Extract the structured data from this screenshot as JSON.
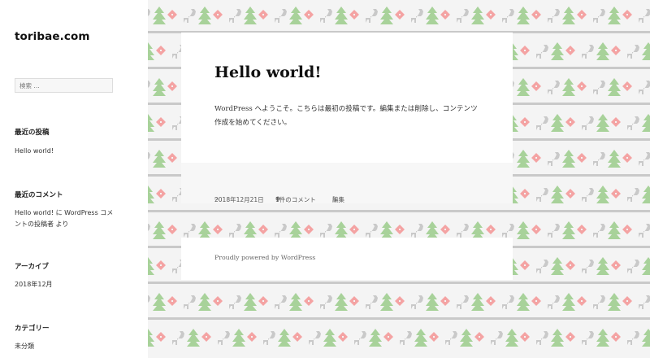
{
  "site": {
    "title": "toribae.com"
  },
  "search": {
    "placeholder": "検索 …"
  },
  "widgets": {
    "recent_posts": {
      "title": "最近の投稿",
      "items": [
        "Hello world!"
      ]
    },
    "recent_comments": {
      "title": "最近のコメント",
      "text": "Hello world! に WordPress コメントの投稿者 より"
    },
    "archives": {
      "title": "アーカイブ",
      "items": [
        "2018年12月"
      ]
    },
    "categories": {
      "title": "カテゴリー",
      "items": [
        "未分類"
      ]
    }
  },
  "post": {
    "title": "Hello world!",
    "body": "WordPress へようこそ。こちらは最初の投稿です。編集または削除し、コンテンツ作成を始めてください。",
    "date": "2018年12月21日",
    "comments": "1件のコメント",
    "edit": "編集"
  },
  "footer": {
    "credit": "Proudly powered by WordPress"
  },
  "colors": {
    "pattern_red": "#f4a3a3",
    "pattern_green": "#a8d29a",
    "pattern_gray": "#c9c9c9"
  },
  "icons": {
    "date": "calendar-icon",
    "comments": "comment-icon",
    "edit": "pencil-icon"
  }
}
